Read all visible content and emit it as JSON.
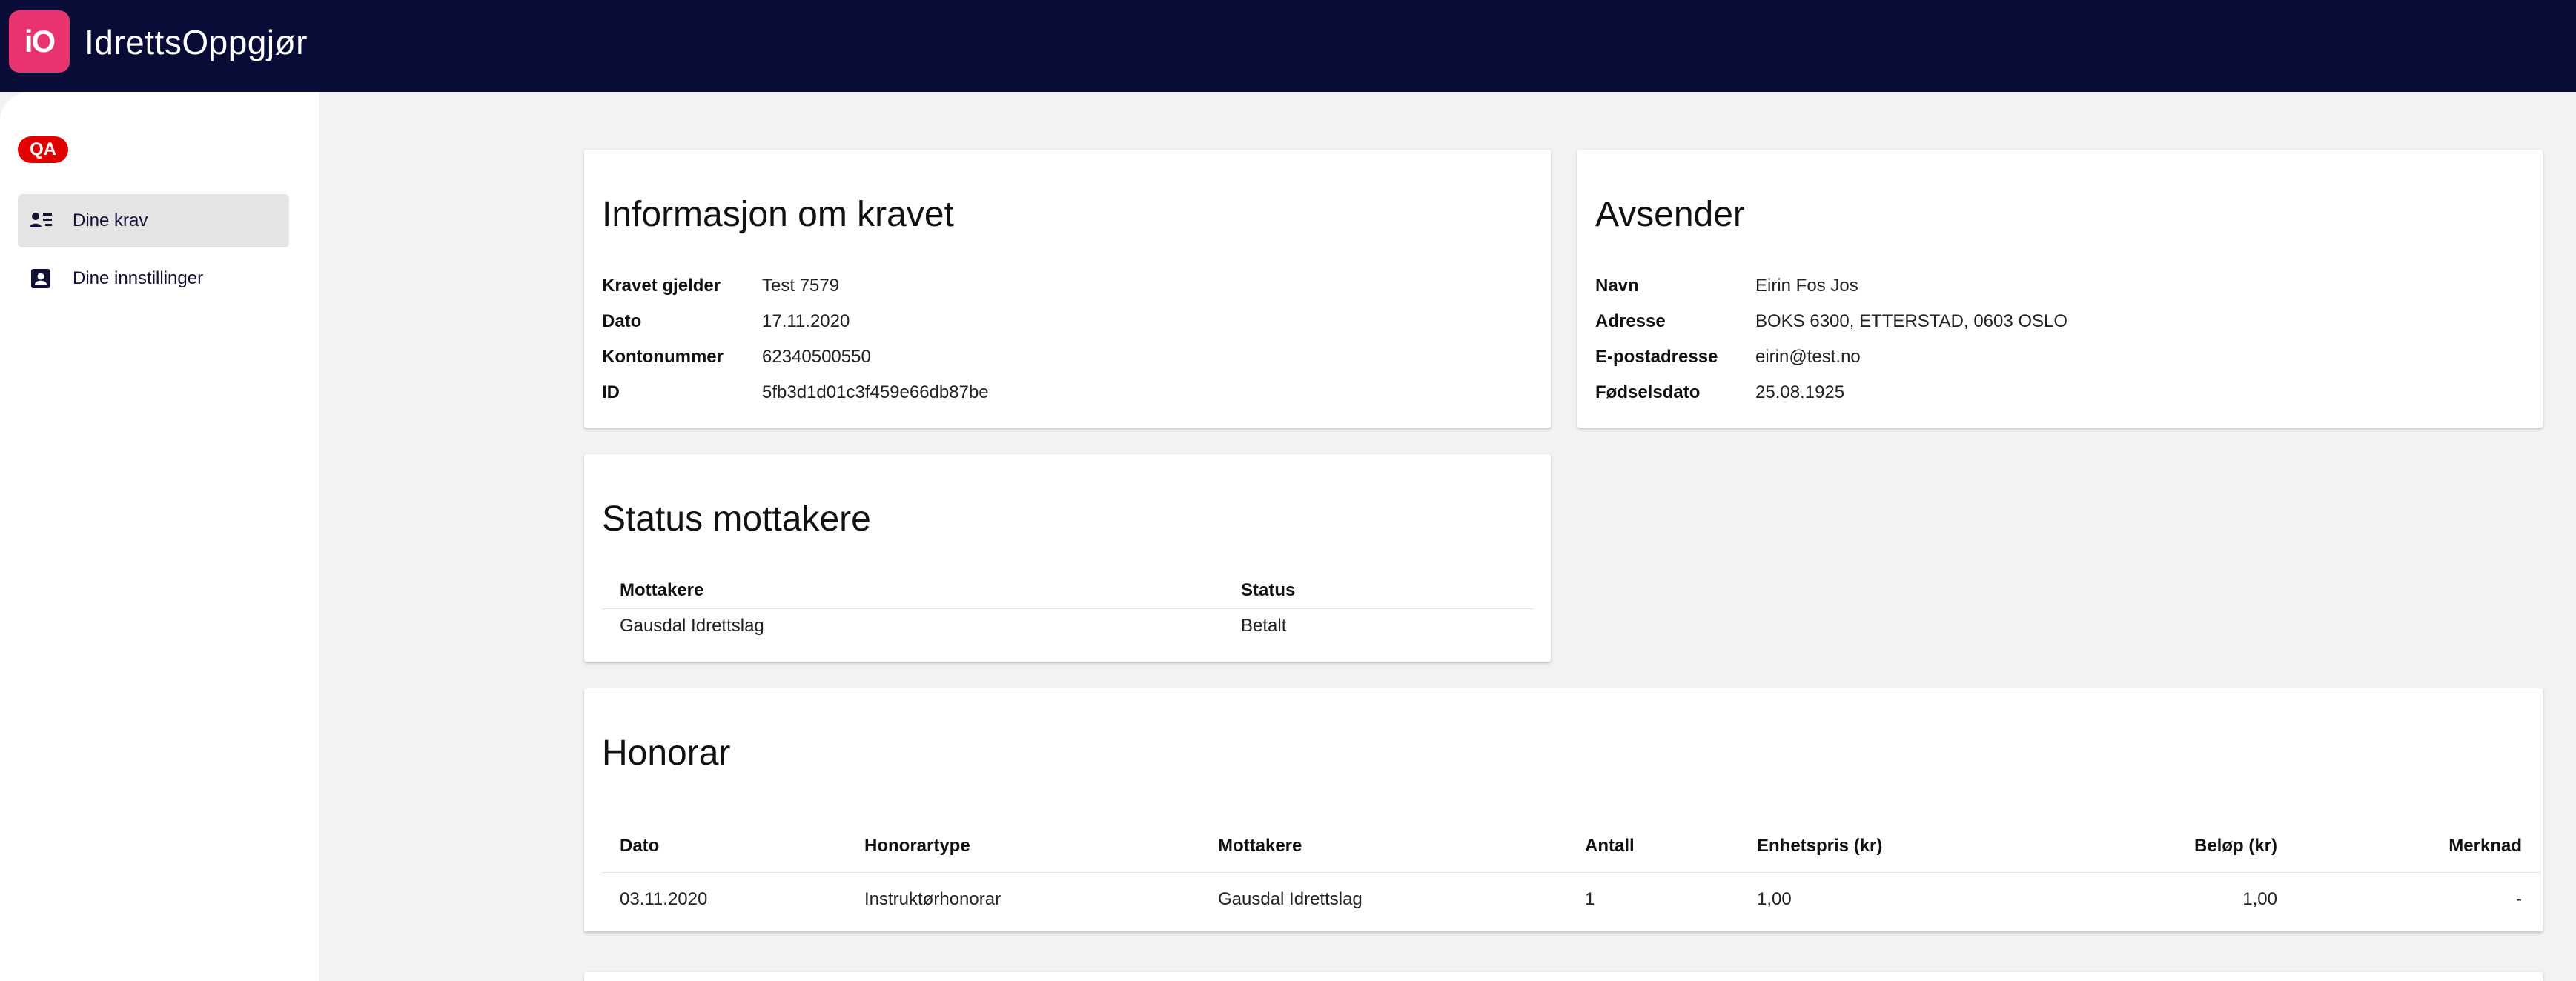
{
  "header": {
    "logo_text": "iO",
    "brand": "IdrettsOppgjør",
    "bg_color": "#0a0c38",
    "logo_color": "#e8336f"
  },
  "sidebar": {
    "env_badge": "QA",
    "items": [
      {
        "label": "Dine krav",
        "icon": "person-list-icon",
        "active": true
      },
      {
        "label": "Dine innstillinger",
        "icon": "contact-card-icon",
        "active": false
      }
    ]
  },
  "claim_info": {
    "title": "Informasjon om kravet",
    "rows": [
      {
        "label": "Kravet gjelder",
        "value": "Test 7579"
      },
      {
        "label": "Dato",
        "value": "17.11.2020"
      },
      {
        "label": "Kontonummer",
        "value": "62340500550"
      },
      {
        "label": "ID",
        "value": "5fb3d1d01c3f459e66db87be"
      }
    ]
  },
  "sender": {
    "title": "Avsender",
    "rows": [
      {
        "label": "Navn",
        "value": "Eirin Fos Jos"
      },
      {
        "label": "Adresse",
        "value": "BOKS 6300, ETTERSTAD, 0603 OSLO"
      },
      {
        "label": "E-postadresse",
        "value": "eirin@test.no"
      },
      {
        "label": "Fødselsdato",
        "value": "25.08.1925"
      }
    ]
  },
  "status": {
    "title": "Status mottakere",
    "headers": [
      "Mottakere",
      "Status"
    ],
    "rows": [
      [
        "Gausdal Idrettslag",
        "Betalt"
      ]
    ]
  },
  "honorar": {
    "title": "Honorar",
    "headers": [
      "Dato",
      "Honorartype",
      "Mottakere",
      "Antall",
      "Enhetspris (kr)",
      "Beløp (kr)",
      "Merknad"
    ],
    "rows": [
      [
        "03.11.2020",
        "Instruktørhonorar",
        "Gausdal Idrettslag",
        "1",
        "1,00",
        "1,00",
        "-"
      ]
    ]
  }
}
